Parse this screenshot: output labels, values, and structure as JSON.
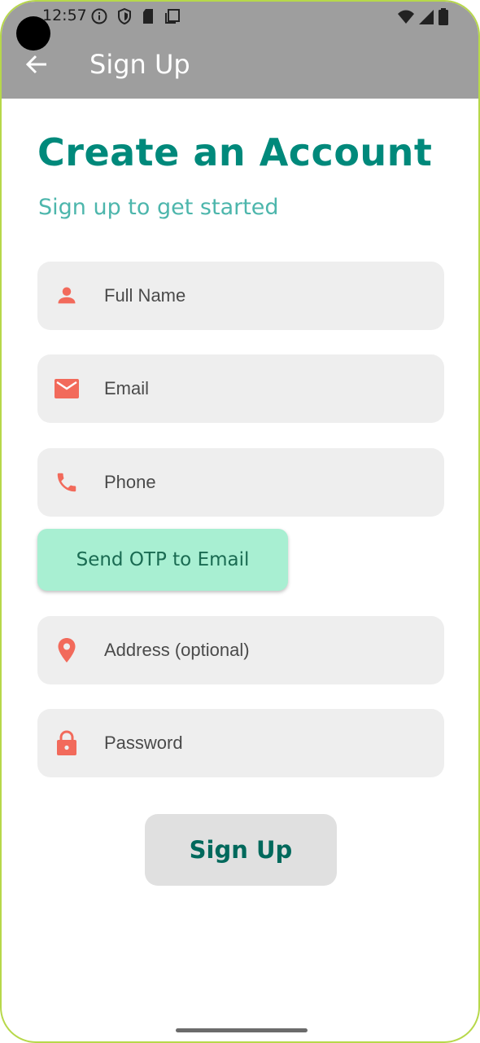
{
  "status_bar": {
    "time": "12:57"
  },
  "app_bar": {
    "title": "Sign Up",
    "back_icon": "arrow-back-icon"
  },
  "header": {
    "title": "Create an Account",
    "subtitle": "Sign up to get started"
  },
  "form": {
    "fields": [
      {
        "placeholder": "Full Name",
        "value": "",
        "icon": "person-icon"
      },
      {
        "placeholder": "Email",
        "value": "",
        "icon": "mail-icon"
      },
      {
        "placeholder": "Phone",
        "value": "",
        "icon": "phone-icon"
      },
      {
        "placeholder": "Address (optional)",
        "value": "",
        "icon": "location-pin-icon"
      },
      {
        "placeholder": "Password",
        "value": "",
        "icon": "lock-icon"
      }
    ],
    "otp_button_label": "Send OTP to Email",
    "submit_label": "Sign Up"
  },
  "colors": {
    "primary": "#00897b",
    "accent_icon": "#f26a5b",
    "otp_button": "#a8efd2",
    "app_bar": "#9e9e9e",
    "field_background": "#eeeeee"
  }
}
